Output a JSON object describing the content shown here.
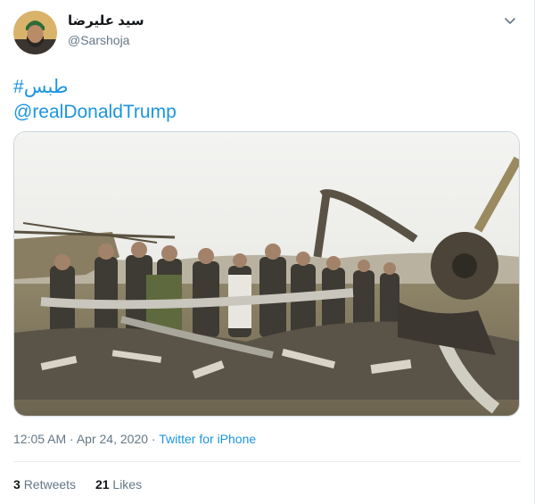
{
  "user": {
    "display_name": "سید علیرضا",
    "handle": "@Sarshoja"
  },
  "tweet": {
    "hashtag": "#طبس",
    "mention": "@realDonaldTrump",
    "time": "12:05 AM",
    "separator": "·",
    "date": "Apr 24, 2020",
    "source": "Twitter for iPhone"
  },
  "stats": {
    "retweets_count": "3",
    "retweets_label": "Retweets",
    "likes_count": "21",
    "likes_label": "Likes"
  },
  "icons": {
    "menu": "chevron-down-icon"
  },
  "colors": {
    "link": "#1b95e0",
    "secondary": "#657786",
    "border": "#ccd6dd"
  }
}
